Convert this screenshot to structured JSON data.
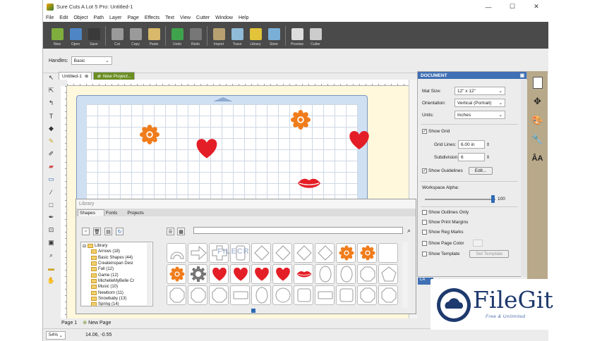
{
  "window": {
    "title": "Sure Cuts A Lot 5 Pro: Untitled-1",
    "controls": [
      "—",
      "☐",
      "✕"
    ]
  },
  "menu": [
    "File",
    "Edit",
    "Object",
    "Path",
    "Layer",
    "Page",
    "Effects",
    "Text",
    "View",
    "Cutter",
    "Window",
    "Help"
  ],
  "toolbar": [
    {
      "label": "New",
      "icon": "new-icon",
      "color": "#7fae3e"
    },
    {
      "label": "Open",
      "icon": "open-icon",
      "color": "#4e86c4"
    },
    {
      "label": "Save",
      "icon": "save-icon",
      "color": "#3a3a3a"
    },
    {
      "label": "Cut",
      "icon": "cut-icon",
      "color": "#9a9a9a"
    },
    {
      "label": "Copy",
      "icon": "copy-icon",
      "color": "#9a9a9a"
    },
    {
      "label": "Paste",
      "icon": "paste-icon",
      "color": "#d8b86a"
    },
    {
      "label": "Undo",
      "icon": "undo-icon",
      "color": "#3fa34d"
    },
    {
      "label": "Redo",
      "icon": "redo-icon",
      "color": "#777777"
    },
    {
      "label": "Import",
      "icon": "import-icon",
      "color": "#b8a070"
    },
    {
      "label": "Trace",
      "icon": "trace-icon",
      "color": "#8fbbd8"
    },
    {
      "label": "Library",
      "icon": "library-icon",
      "color": "#e2c33a"
    },
    {
      "label": "Store",
      "icon": "store-icon",
      "color": "#7ab0d8"
    },
    {
      "label": "Preview",
      "icon": "preview-icon",
      "color": "#dddddd"
    },
    {
      "label": "Cutter",
      "icon": "cutter-icon",
      "color": "#cccccc"
    }
  ],
  "handles": {
    "label": "Handles:",
    "value": "Basic"
  },
  "doc_tabs": {
    "active": "Untitled-1",
    "new": "New Project..."
  },
  "page_tabs": {
    "page": "Page 1",
    "new": "New Page"
  },
  "status": {
    "zoom": "54%",
    "coords": "14.06, -0.55"
  },
  "library": {
    "title": "Library",
    "tabs": [
      "Shapes",
      "Fonts",
      "Projects"
    ],
    "tree": [
      {
        "label": "Library",
        "indent": 0
      },
      {
        "label": "Arrows (18)",
        "indent": 1
      },
      {
        "label": "Basic Shapes (44)",
        "indent": 1
      },
      {
        "label": "Createinspan Desi",
        "indent": 1
      },
      {
        "label": "Fall (12)",
        "indent": 1
      },
      {
        "label": "Game (12)",
        "indent": 1
      },
      {
        "label": "MichelleMyBelle Cr",
        "indent": 1
      },
      {
        "label": "Music (10)",
        "indent": 1
      },
      {
        "label": "Newborn (11)",
        "indent": 1
      },
      {
        "label": "Snowbaby (13)",
        "indent": 1
      },
      {
        "label": "Spring (14)",
        "indent": 1
      }
    ],
    "shapes": [
      "arch",
      "arrow-right",
      "cross",
      "rounded-rect",
      "diamond",
      "diamond",
      "diamond",
      "diamond",
      "flower",
      "flower",
      "blank",
      "flower",
      "gear",
      "heart",
      "heart",
      "heart",
      "heart",
      "lips",
      "oval",
      "oval",
      "octagon",
      "pentagon",
      "octagon",
      "octagon",
      "octagon",
      "rect",
      "oval",
      "circle",
      "square",
      "rect",
      "square",
      "octagon",
      "octagon"
    ],
    "watermark": "FILECR"
  },
  "document": {
    "title": "DOCUMENT",
    "mat_size": {
      "label": "Mat Size:",
      "value": "12\" x 12\""
    },
    "orientation": {
      "label": "Orientation:",
      "value": "Vertical (Portrait)"
    },
    "units": {
      "label": "Units:",
      "value": "Inches"
    },
    "show_grid": {
      "label": "Show Grid",
      "checked": true
    },
    "grid_lines": {
      "label": "Grid Lines:",
      "value": "6.00 in"
    },
    "subdivision": {
      "label": "Subdivision:",
      "value": "6"
    },
    "show_guidelines": {
      "label": "Show Guidelines",
      "checked": true
    },
    "edit_button": "Edit...",
    "workspace_alpha": {
      "label": "Workspace Alpha:",
      "value": "100",
      "level": 0.97
    },
    "options": [
      {
        "label": "Show Outlines Only",
        "checked": false
      },
      {
        "label": "Show Print Margins",
        "checked": false
      },
      {
        "label": "Show Reg Marks",
        "checked": false
      },
      {
        "label": "Show Page Color",
        "checked": false
      },
      {
        "label": "Show Template",
        "checked": false
      }
    ],
    "set_template_button": "Set Template",
    "layers_tab_fragment": "LA"
  },
  "canvas_shapes": [
    {
      "kind": "flower",
      "color": "#f07c1b"
    },
    {
      "kind": "heart",
      "color": "#e41e26"
    },
    {
      "kind": "flower",
      "color": "#f07c1b"
    },
    {
      "kind": "heart",
      "color": "#e41e26"
    },
    {
      "kind": "lips",
      "color": "#e41e26"
    }
  ],
  "badge": {
    "name": "FileGit",
    "tagline": "Free & Unlimited",
    "color": "#1e3a6e"
  }
}
